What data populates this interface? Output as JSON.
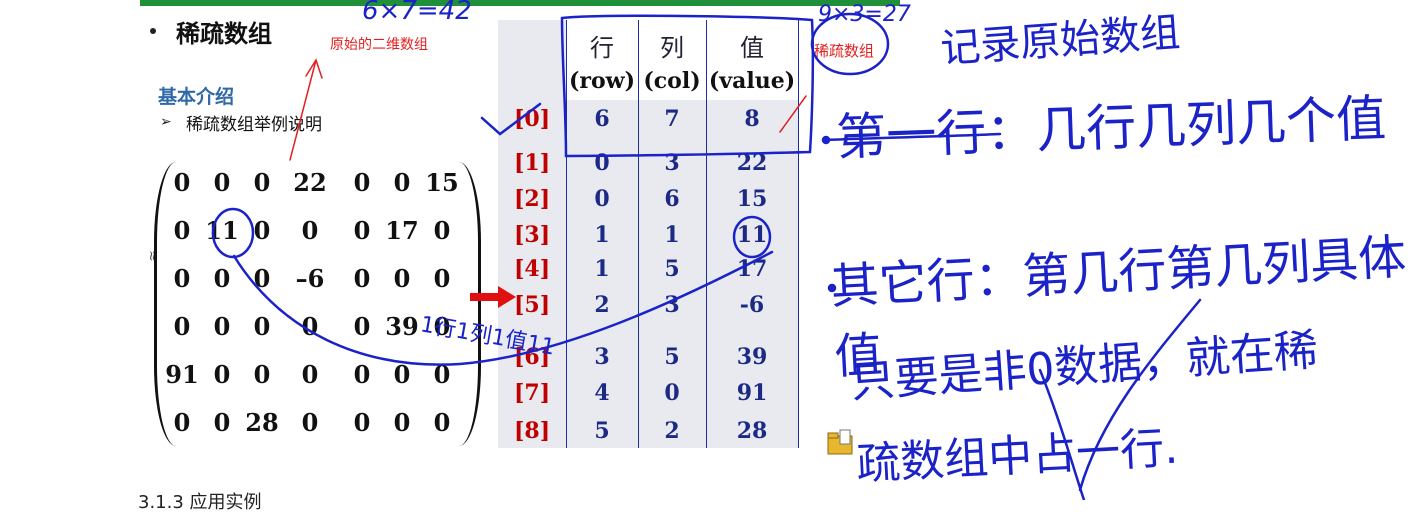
{
  "heading": {
    "title": "稀疏数组",
    "red_label": "原始的二维数组"
  },
  "intro": {
    "title": "基本介绍",
    "example": "稀疏数组举例说明"
  },
  "matrix": {
    "rows": [
      [
        "0",
        "0",
        "0",
        "22",
        "0",
        "0",
        "15"
      ],
      [
        "0",
        "11",
        "0",
        "0",
        "0",
        "17",
        "0"
      ],
      [
        "0",
        "0",
        "0",
        "–6",
        "0",
        "0",
        "0"
      ],
      [
        "0",
        "0",
        "0",
        "0",
        "0",
        "39",
        "0"
      ],
      [
        "91",
        "0",
        "0",
        "0",
        "0",
        "0",
        "0"
      ],
      [
        "0",
        "0",
        "28",
        "0",
        "0",
        "0",
        "0"
      ]
    ]
  },
  "sparse_table": {
    "header_cn": [
      "行",
      "列",
      "值"
    ],
    "header_en": [
      "(row)",
      "(col)",
      "(value)"
    ],
    "label": "稀疏数组",
    "rows": [
      {
        "idx": "[0]",
        "row": "6",
        "col": "7",
        "value": "8"
      },
      {
        "idx": "[1]",
        "row": "0",
        "col": "3",
        "value": "22"
      },
      {
        "idx": "[2]",
        "row": "0",
        "col": "6",
        "value": "15"
      },
      {
        "idx": "[3]",
        "row": "1",
        "col": "1",
        "value": "11"
      },
      {
        "idx": "[4]",
        "row": "1",
        "col": "5",
        "value": "17"
      },
      {
        "idx": "[5]",
        "row": "2",
        "col": "3",
        "value": "-6"
      },
      {
        "idx": "[6]",
        "row": "3",
        "col": "5",
        "value": "39"
      },
      {
        "idx": "[7]",
        "row": "4",
        "col": "0",
        "value": "91"
      },
      {
        "idx": "[8]",
        "row": "5",
        "col": "2",
        "value": "28"
      }
    ]
  },
  "handwriting": {
    "calc1": "6×7=42",
    "calc2": "9×3=27",
    "note1": "记录原始数组",
    "note2": "第一行：几行几列几个值",
    "note3": "其它行：第几行第几列具体值",
    "note4": "只要是非0数据，就在稀",
    "note5": "疏数组中占一行.",
    "note6": "1行1列1值11"
  },
  "footer": {
    "text": "3.1.3 应用实例"
  },
  "colors": {
    "ink": "#1a22c8",
    "index_red": "#c00000",
    "title_blue": "#2f6aa7"
  }
}
